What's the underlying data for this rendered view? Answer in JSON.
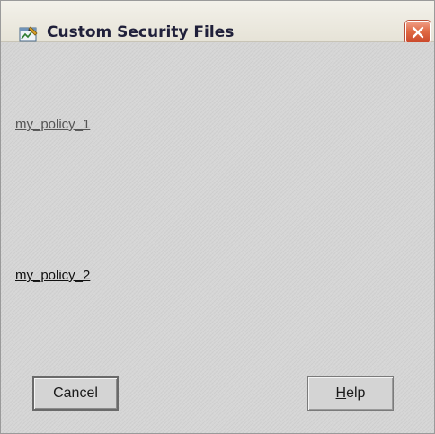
{
  "window": {
    "title": "Custom Security Files",
    "app_icon": "security-files-icon",
    "close_icon": "close-icon",
    "close_color": "#e06a44"
  },
  "policies": [
    {
      "label": "my_policy_1"
    },
    {
      "label": "my_policy_2"
    }
  ],
  "buttons": {
    "cancel_label": "Cancel",
    "help_mnemonic": "H",
    "help_rest": "elp"
  }
}
